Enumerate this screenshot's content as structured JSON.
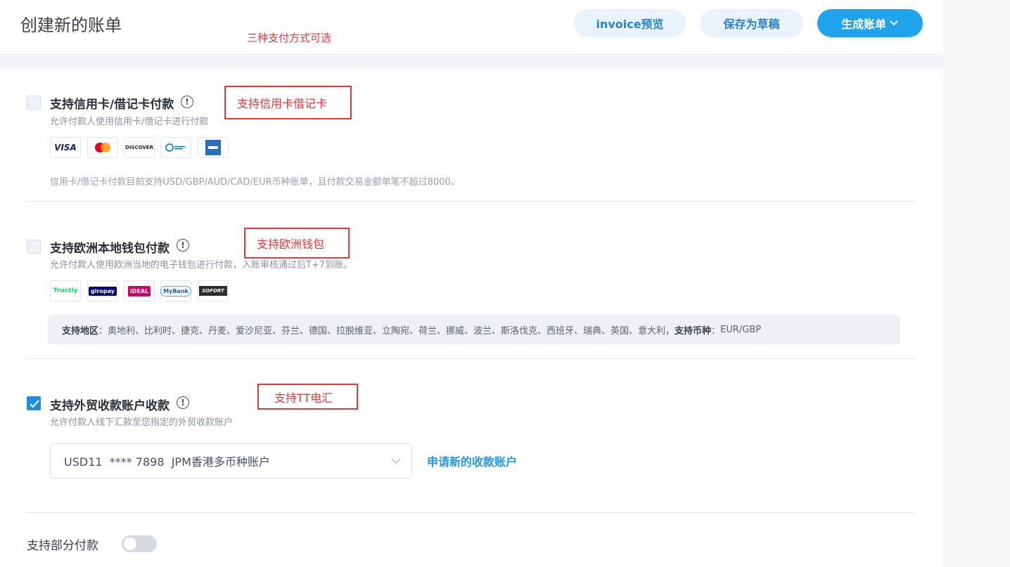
{
  "header": {
    "title": "创建新的账单",
    "preview_label": "invoice预览",
    "draft_label": "保存为草稿",
    "generate_label": "生成账单",
    "annotation": "三种支付方式可选"
  },
  "card_option": {
    "title": "支持信用卡/借记卡付款",
    "description": "允许付款人使用信用卡/借记卡进行付款",
    "note": "信用卡/借记卡付款目前支持USD/GBP/AUD/CAD/EUR币种账单，且付款交易金额单笔不超过8000。",
    "annotation": "支持信用卡借记卡",
    "checked": false,
    "logos": [
      "VISA",
      "Mastercard",
      "DISCOVER",
      "Diners Club",
      "AMEX"
    ]
  },
  "wallet_option": {
    "title": "支持欧洲本地钱包付款",
    "description": "允许付款人使用欧洲当地的电子钱包进行付款，入账审核通过后T+7到账。",
    "annotation": "支持欧洲钱包",
    "checked": false,
    "logos": [
      "Trustly",
      "giropay",
      "iDEAL",
      "MyBank",
      "SOFORT"
    ],
    "region_label": "支持地区",
    "regions": "奥地利、比利时、捷克、丹麦、爱沙尼亚、芬兰、德国、拉脱维亚、立陶宛、荷兰、挪威、波兰、斯洛伐克、西班牙、瑞典、英国、意大利，",
    "currency_label": "支持币种",
    "currencies": "EUR/GBP"
  },
  "tt_option": {
    "title": "支持外贸收款账户收款",
    "description": "允许付款人线下汇款至您指定的外贸收款账户",
    "annotation": "支持TT电汇",
    "checked": true,
    "selected_account": "USD11  **** 7898  JPM香港多币种账户",
    "apply_link": "申请新的收款账户"
  },
  "partial_payment": {
    "label": "支持部分付款",
    "enabled": false
  },
  "colors": {
    "primary": "#1fa3ec",
    "annotation_red": "#e03a3a"
  }
}
